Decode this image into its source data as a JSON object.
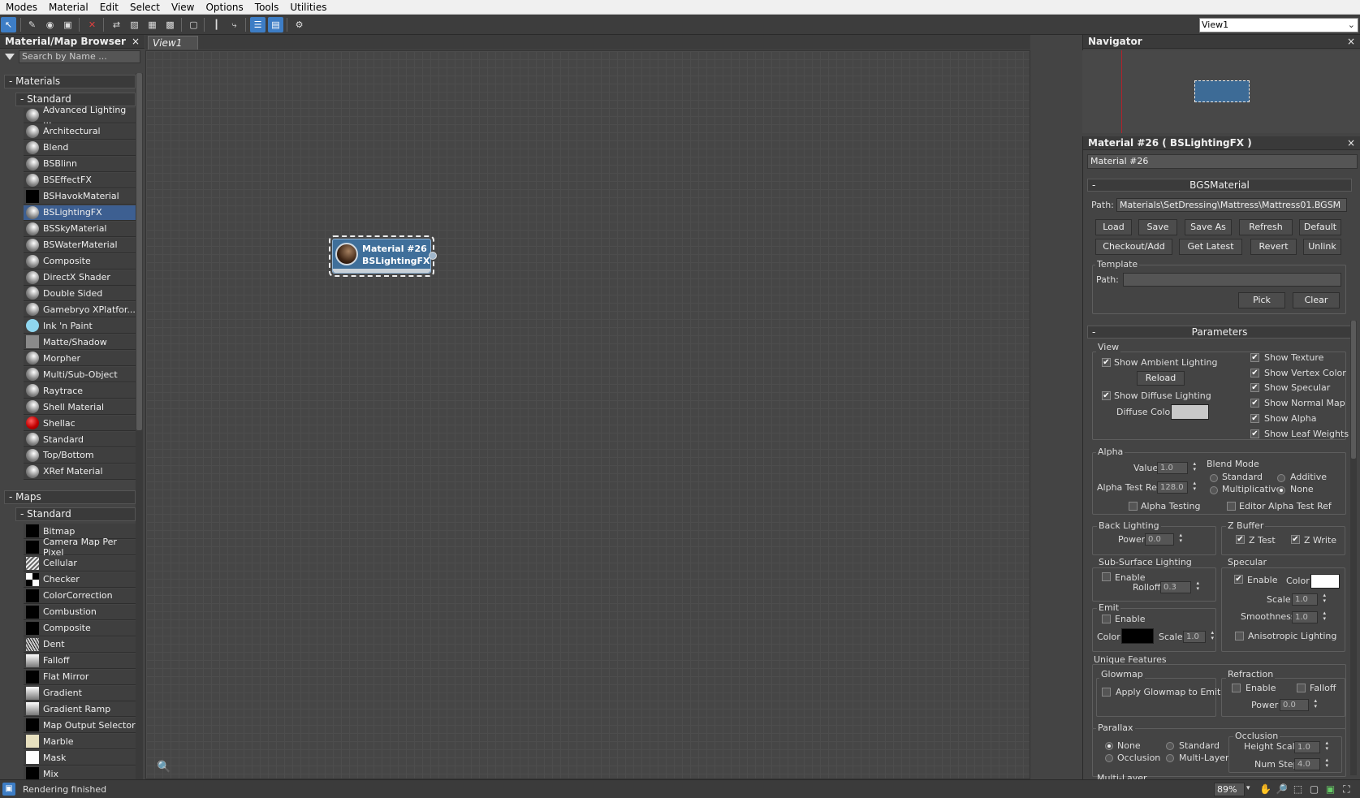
{
  "menu": [
    "Modes",
    "Material",
    "Edit",
    "Select",
    "View",
    "Options",
    "Tools",
    "Utilities"
  ],
  "view_select": "View1",
  "browser": {
    "title": "Material/Map Browser",
    "search_placeholder": "Search by Name ...",
    "materials_group": "Materials",
    "materials_sub": "Standard",
    "materials": [
      {
        "label": "Advanced Lighting ...",
        "swatch": "mat"
      },
      {
        "label": "Architectural",
        "swatch": "mat"
      },
      {
        "label": "Blend",
        "swatch": "mat"
      },
      {
        "label": "BSBlinn",
        "swatch": "mat"
      },
      {
        "label": "BSEffectFX",
        "swatch": "mat"
      },
      {
        "label": "BSHavokMaterial",
        "swatch": "black"
      },
      {
        "label": "BSLightingFX",
        "swatch": "mat",
        "selected": true
      },
      {
        "label": "BSSkyMaterial",
        "swatch": "mat"
      },
      {
        "label": "BSWaterMaterial",
        "swatch": "mat"
      },
      {
        "label": "Composite",
        "swatch": "mat"
      },
      {
        "label": "DirectX Shader",
        "swatch": "mat"
      },
      {
        "label": "Double Sided",
        "swatch": "mat"
      },
      {
        "label": "Gamebryo XPlatfor...",
        "swatch": "mat"
      },
      {
        "label": "Ink 'n Paint",
        "swatch": "cyan"
      },
      {
        "label": "Matte/Shadow",
        "swatch": "gray"
      },
      {
        "label": "Morpher",
        "swatch": "mat"
      },
      {
        "label": "Multi/Sub-Object",
        "swatch": "mat"
      },
      {
        "label": "Raytrace",
        "swatch": "mat"
      },
      {
        "label": "Shell Material",
        "swatch": "mat"
      },
      {
        "label": "Shellac",
        "swatch": "red"
      },
      {
        "label": "Standard",
        "swatch": "mat"
      },
      {
        "label": "Top/Bottom",
        "swatch": "mat"
      },
      {
        "label": "XRef Material",
        "swatch": "mat"
      }
    ],
    "maps_group": "Maps",
    "maps_sub": "Standard",
    "maps": [
      {
        "label": "Bitmap",
        "swatch": "black"
      },
      {
        "label": "Camera Map Per Pixel",
        "swatch": "black"
      },
      {
        "label": "Cellular",
        "swatch": "cell"
      },
      {
        "label": "Checker",
        "swatch": "check"
      },
      {
        "label": "ColorCorrection",
        "swatch": "black"
      },
      {
        "label": "Combustion",
        "swatch": "black"
      },
      {
        "label": "Composite",
        "swatch": "black"
      },
      {
        "label": "Dent",
        "swatch": "dent"
      },
      {
        "label": "Falloff",
        "swatch": "grad"
      },
      {
        "label": "Flat Mirror",
        "swatch": "black"
      },
      {
        "label": "Gradient",
        "swatch": "grad"
      },
      {
        "label": "Gradient Ramp",
        "swatch": "grad"
      },
      {
        "label": "Map Output Selector",
        "swatch": "black"
      },
      {
        "label": "Marble",
        "swatch": "marble"
      },
      {
        "label": "Mask",
        "swatch": "white"
      },
      {
        "label": "Mix",
        "swatch": "black"
      }
    ]
  },
  "view_tab": "View1",
  "node": {
    "name": "Material #26",
    "type": "BSLightingFX"
  },
  "navigator": {
    "title": "Navigator"
  },
  "props": {
    "title": "Material #26  ( BSLightingFX )",
    "name": "Material #26",
    "bgs": {
      "rollout": "BGSMaterial",
      "path_label": "Path:",
      "path": "Materials\\SetDressing\\Mattress\\Mattress01.BGSM",
      "buttons1": [
        "Load",
        "Save",
        "Save As",
        "Refresh",
        "Default"
      ],
      "buttons2": [
        "Checkout/Add",
        "Get Latest",
        "Revert",
        "Unlink"
      ],
      "template": "Template",
      "template_path_label": "Path:",
      "template_path": "",
      "pick": "Pick",
      "clear": "Clear"
    },
    "params": {
      "rollout": "Parameters",
      "view": "View",
      "show_ambient": "Show Ambient Lighting",
      "reload": "Reload",
      "show_diffuse": "Show Diffuse Lighting",
      "diffuse_color": "Diffuse Color",
      "right_checks": [
        "Show Texture",
        "Show Vertex Color",
        "Show Specular",
        "Show Normal Map",
        "Show Alpha",
        "Show Leaf Weights"
      ],
      "alpha": "Alpha",
      "value_label": "Value",
      "value": "1.0",
      "alpha_test_ref_label": "Alpha Test Ref",
      "alpha_test_ref": "128.0",
      "blend_mode": "Blend Mode",
      "blend_standard": "Standard",
      "blend_additive": "Additive",
      "blend_multiplicative": "Multiplicative",
      "blend_none": "None",
      "alpha_testing": "Alpha Testing",
      "editor_alpha_test_ref": "Editor Alpha Test Ref",
      "back_lighting": "Back Lighting",
      "power_label": "Power",
      "power": "0.0",
      "z_buffer": "Z Buffer",
      "z_test": "Z Test",
      "z_write": "Z Write",
      "sub_surface": "Sub-Surface Lighting",
      "enable": "Enable",
      "rolloff_label": "Rolloff",
      "rolloff": "0.3",
      "specular": "Specular",
      "color_label": "Color",
      "scale_label": "Scale",
      "spec_scale": "1.0",
      "smoothness_label": "Smoothness",
      "smoothness": "1.0",
      "emit": "Emit",
      "emit_scale": "1.0",
      "anisotropic": "Anisotropic Lighting",
      "unique": "Unique Features",
      "glowmap": "Glowmap",
      "apply_glowmap": "Apply Glowmap to Emit",
      "refraction": "Refraction",
      "falloff": "Falloff",
      "refr_power": "0.0",
      "parallax": "Parallax",
      "par_none": "None",
      "par_standard": "Standard",
      "par_occlusion": "Occlusion",
      "par_multilayer": "Multi-Layer",
      "occlusion_box": "Occlusion",
      "height_scale_label": "Height Scale",
      "height_scale": "1.0",
      "num_steps_label": "Num Steps",
      "num_steps": "4.0",
      "multi_layer": "Multi-Layer"
    }
  },
  "status": {
    "text": "Rendering finished",
    "zoom": "89%"
  },
  "colors": {
    "accent": "#3d7dc5",
    "selected": "#3d5f91",
    "node": "#3f6f9a",
    "diffuse": "#c8c8c8",
    "emit": "#000000",
    "specular": "#ffffff"
  }
}
